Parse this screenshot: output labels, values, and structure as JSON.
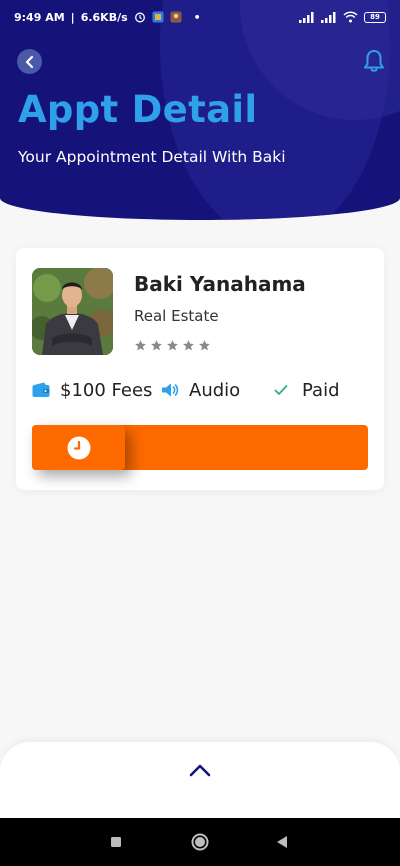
{
  "status_bar": {
    "time": "9:49 AM",
    "speed": "6.6KB/s",
    "battery": "89"
  },
  "header": {
    "title": "Appt Detail",
    "subtitle": "Your Appointment Detail With Baki",
    "back_icon": "chevron-left-icon",
    "notification_icon": "bell-icon"
  },
  "card": {
    "name": "Baki Yanahama",
    "role": "Real Estate",
    "rating": 0,
    "rating_max": 5,
    "fees_label": "$100 Fees",
    "type_label": "Audio",
    "status_label": "Paid"
  },
  "action": {
    "icon": "clock-icon"
  },
  "colors": {
    "header_bg": "#15137a",
    "title": "#2fa0ea",
    "accent": "#ff6a00",
    "icon_blue": "#2fa0ea",
    "paid_check": "#2bb08a",
    "star": "#8a8a8a"
  }
}
